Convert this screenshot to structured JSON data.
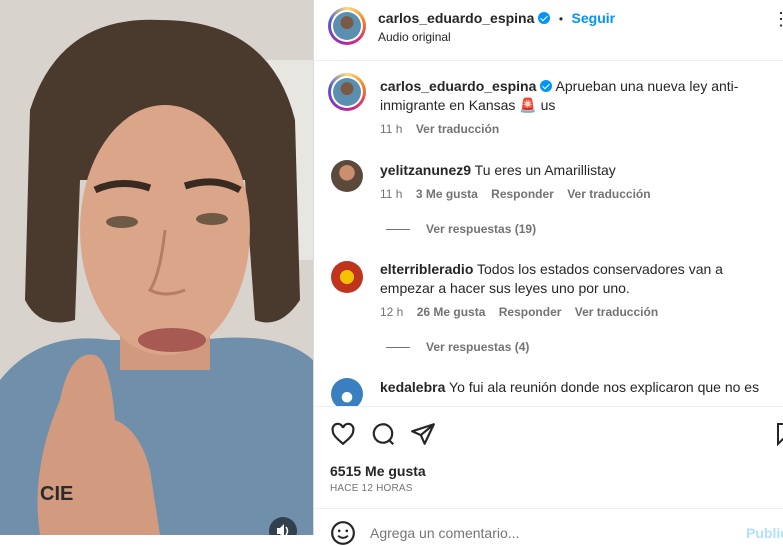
{
  "header": {
    "username": "carlos_eduardo_espina",
    "separator": "•",
    "follow_label": "Seguir",
    "audio": "Audio original",
    "more": "⋮"
  },
  "caption": {
    "username": "carlos_eduardo_espina",
    "text": "Aprueban una nueva ley anti-inmigrante en Kansas 🚨 us",
    "time": "11 h",
    "translate": "Ver traducción"
  },
  "comments": [
    {
      "username": "yelitzanunez9",
      "text": "Tu eres un Amarillistay",
      "time": "11 h",
      "likes": "3 Me gusta",
      "reply": "Responder",
      "translate": "Ver traducción",
      "replies": "Ver respuestas (19)"
    },
    {
      "username": "elterribleradio",
      "text": "Todos los estados conservadores van a empezar a hacer sus leyes uno por uno.",
      "time": "12 h",
      "likes": "26 Me gusta",
      "reply": "Responder",
      "translate": "Ver traducción",
      "replies": "Ver respuestas (4)"
    },
    {
      "username": "kedalebra",
      "text": "Yo fui ala reunión donde nos explicaron que no es"
    }
  ],
  "footer": {
    "likes": "6515 Me gusta",
    "date": "HACE 12 HORAS",
    "comment_placeholder": "Agrega un comentario...",
    "publish": "Publicar"
  },
  "colors": {
    "accent": "#0095f6",
    "text": "#262626",
    "muted": "#737373"
  }
}
